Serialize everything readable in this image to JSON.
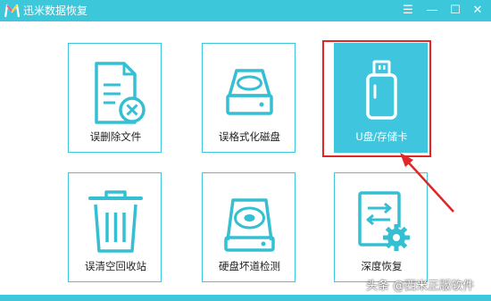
{
  "window": {
    "title": "迅米数据恢复",
    "controls": {
      "menu": "☰",
      "minimize": "—",
      "maximize": "☐",
      "close": "✕"
    }
  },
  "tiles": [
    {
      "label": "误删除文件",
      "icon": "deleted-file-icon"
    },
    {
      "label": "误格式化磁盘",
      "icon": "formatted-disk-icon"
    },
    {
      "label": "U盘/存储卡",
      "icon": "usb-drive-icon",
      "active": true
    },
    {
      "label": "误清空回收站",
      "icon": "recycle-bin-icon"
    },
    {
      "label": "硬盘坏道检测",
      "icon": "hard-disk-check-icon"
    },
    {
      "label": "深度恢复",
      "icon": "deep-recovery-icon"
    }
  ],
  "watermark": "头条 @西米正版软件",
  "colors": {
    "accent": "#3cc7da",
    "highlight": "#e02727",
    "icon": "#35bfd2"
  }
}
